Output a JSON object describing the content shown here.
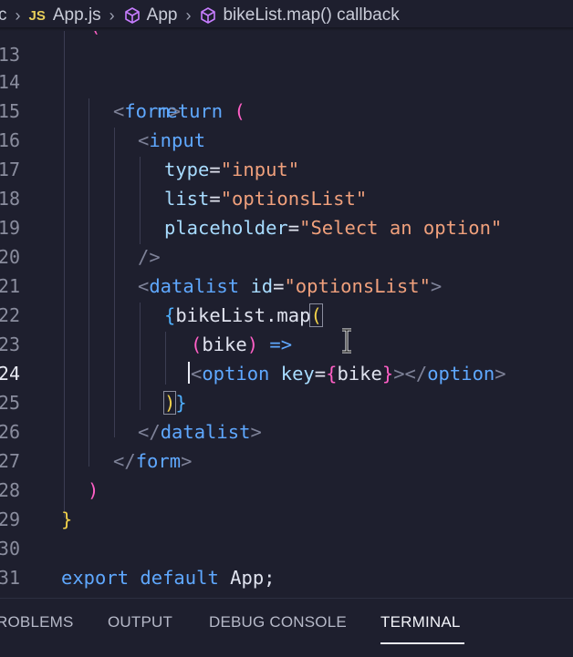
{
  "breadcrumb": {
    "lead": "c",
    "file_badge": "JS",
    "file": "App.js",
    "component": "App",
    "callback": "bikeList.map() callback",
    "component_icon": "cube-icon",
    "callback_icon": "cube-icon"
  },
  "editor": {
    "top_fragment": "(",
    "line_numbers": [
      "13",
      "14",
      "15",
      "16",
      "17",
      "18",
      "19",
      "20",
      "21",
      "22",
      "23",
      "24",
      "25",
      "26",
      "27",
      "28",
      "29",
      "30",
      "31"
    ],
    "active_line": "24",
    "tokens": {
      "return_kw": "return",
      "paren_open": "(",
      "form_open_lt": "<",
      "form_tag": "form",
      "form_open_gt": ">",
      "input_lt": "<",
      "input_tag": "input",
      "type_attr": "type",
      "type_eq": "=",
      "type_val": "\"input\"",
      "list_attr": "list",
      "list_eq": "=",
      "list_val": "\"optionsList\"",
      "ph_attr": "placeholder",
      "ph_eq": "=",
      "ph_val": "\"Select an option\"",
      "self_close": "/>",
      "datalist_lt": "<",
      "datalist_tag": "datalist",
      "id_attr": "id",
      "id_eq": "=",
      "id_val": "\"optionsList\"",
      "datalist_gt": ">",
      "brace_open": "{",
      "map_expr": "bikeList.map",
      "map_paren": "(",
      "arrow_paren_open": "(",
      "arrow_param": "bike",
      "arrow_paren_close": ")",
      "arrow": "=>",
      "option_lt": "<",
      "option_tag": "option",
      "key_attr": "key",
      "key_eq": "=",
      "key_brace_open": "{",
      "key_val": "bike",
      "key_brace_close": "}",
      "option_close_lt": "></",
      "option_close_tag": "option",
      "option_close_gt": ">",
      "close_paren": ")",
      "close_brace": "}",
      "datalist_close_lt": "</",
      "datalist_close_tag": "datalist",
      "datalist_close_gt": ">",
      "form_close_lt": "</",
      "form_close_tag": "form",
      "form_close_gt": ">",
      "return_close": ")",
      "fn_close": "}",
      "export_kw": "export",
      "default_kw": "default",
      "app_name": "App;"
    }
  },
  "panel": {
    "tabs": [
      "ROBLEMS",
      "OUTPUT",
      "DEBUG CONSOLE",
      "TERMINAL"
    ],
    "active_tab": "TERMINAL"
  },
  "colors": {
    "background": "#1e1f2e",
    "keyword": "#5fa8ff",
    "string": "#f0a07c",
    "attribute": "#a8dcff",
    "bracket_pink": "#ff5fc6",
    "bracket_yellow": "#f2d24a"
  }
}
